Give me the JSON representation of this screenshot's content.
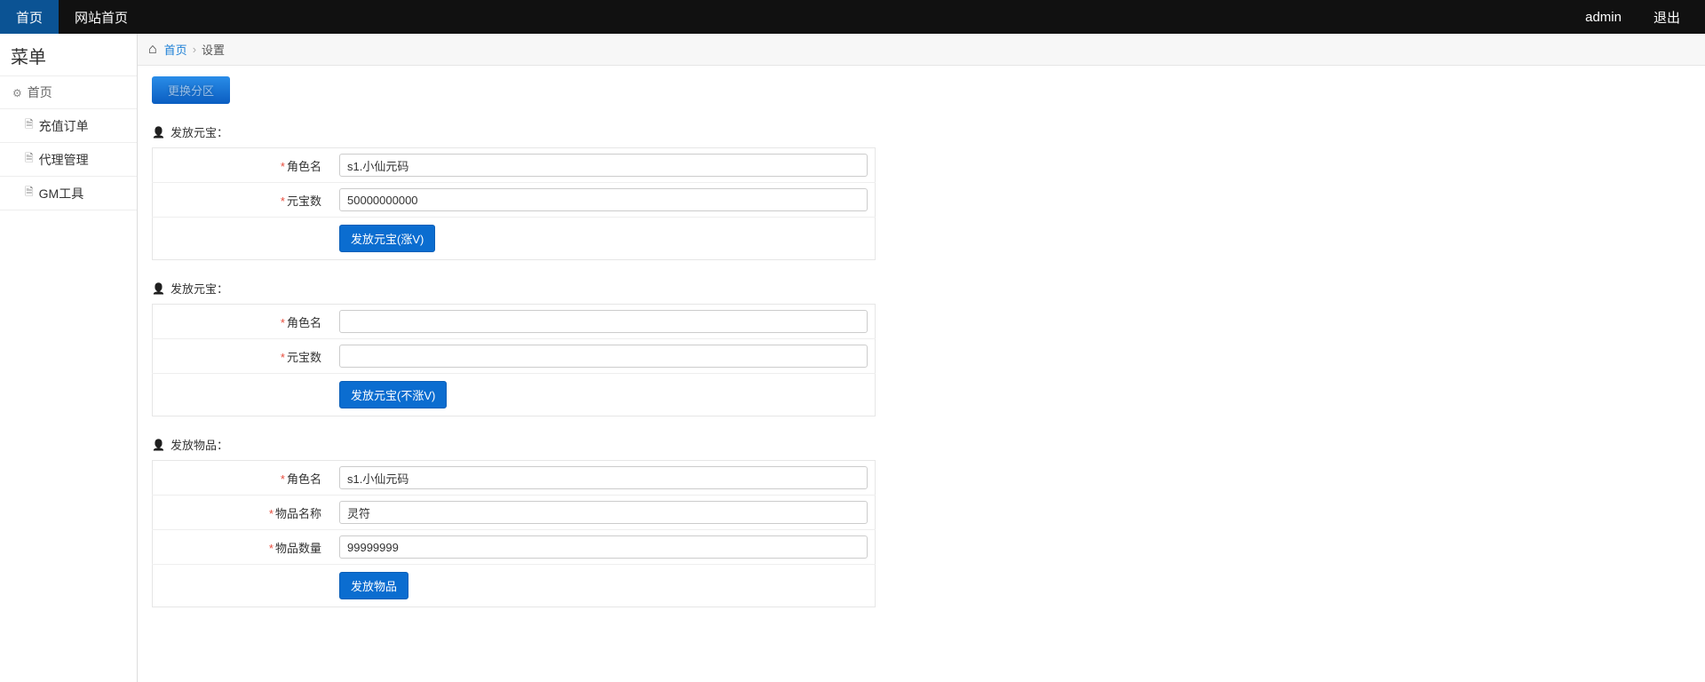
{
  "topnav": {
    "left": [
      {
        "label": "首页",
        "active": true
      },
      {
        "label": "网站首页",
        "active": false
      }
    ],
    "right": {
      "user": "admin",
      "logout": "退出"
    }
  },
  "sidebar": {
    "title": "菜单",
    "group": "首页",
    "items": [
      {
        "label": "充值订单"
      },
      {
        "label": "代理管理"
      },
      {
        "label": "GM工具"
      }
    ]
  },
  "breadcrumb": {
    "home": "首页",
    "current": "设置"
  },
  "zone_button": "更换分区",
  "sections": [
    {
      "title": "发放元宝：",
      "rows": [
        {
          "label": "角色名",
          "value": "s1.小仙元码"
        },
        {
          "label": "元宝数",
          "value": "50000000000"
        }
      ],
      "button": "发放元宝(涨V)"
    },
    {
      "title": "发放元宝：",
      "rows": [
        {
          "label": "角色名",
          "value": ""
        },
        {
          "label": "元宝数",
          "value": ""
        }
      ],
      "button": "发放元宝(不涨V)"
    },
    {
      "title": "发放物品：",
      "rows": [
        {
          "label": "角色名",
          "value": "s1.小仙元码"
        },
        {
          "label": "物品名称",
          "value": "灵符"
        },
        {
          "label": "物品数量",
          "value": "99999999"
        }
      ],
      "button": "发放物品"
    }
  ]
}
